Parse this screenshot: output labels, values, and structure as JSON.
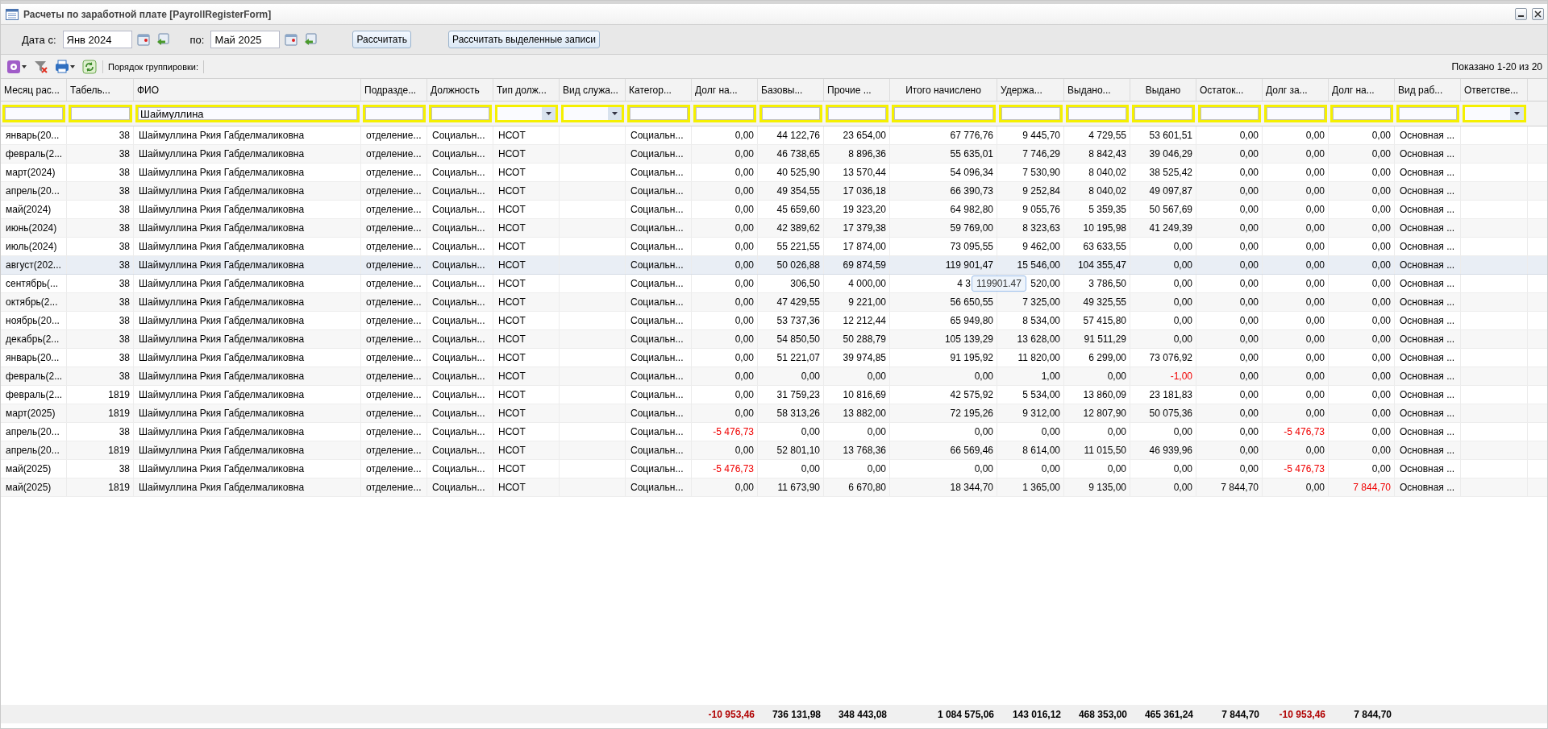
{
  "window": {
    "title": "Расчеты по заработной плате [PayrollRegisterForm]"
  },
  "period": {
    "from_label": "Дата с:",
    "from_value": "Янв 2024",
    "to_label": "по:",
    "to_value": "Май 2025"
  },
  "buttons": [
    "Рассчитать",
    "Рассчитать выделенные записи"
  ],
  "toolbar": {
    "grouping_label": "Порядок группировки:",
    "paging": "Показано 1-20 из 20"
  },
  "columns": [
    {
      "label": "Месяц рас...",
      "kind": "text",
      "header_centered": false,
      "filter": {
        "kind": "field"
      }
    },
    {
      "label": "Табель...",
      "kind": "number",
      "header_centered": false,
      "filter": {
        "kind": "field"
      }
    },
    {
      "label": "ФИО",
      "kind": "text",
      "header_centered": false,
      "filter": {
        "kind": "field",
        "value": "Шаймуллина"
      }
    },
    {
      "label": "Подразде...",
      "kind": "text",
      "header_centered": false,
      "filter": {
        "kind": "field"
      }
    },
    {
      "label": "Должность",
      "kind": "text",
      "header_centered": false,
      "filter": {
        "kind": "field"
      }
    },
    {
      "label": "Тип долж...",
      "kind": "text",
      "header_centered": false,
      "filter": {
        "kind": "combo"
      }
    },
    {
      "label": "Вид служа...",
      "kind": "text",
      "header_centered": false,
      "filter": {
        "kind": "combo"
      }
    },
    {
      "label": "Категор...",
      "kind": "text",
      "header_centered": false,
      "filter": {
        "kind": "field"
      }
    },
    {
      "label": "Долг на...",
      "kind": "number",
      "header_centered": false,
      "filter": {
        "kind": "field"
      },
      "total": {
        "text": "-10 953,46",
        "negative": true
      }
    },
    {
      "label": "Базовы...",
      "kind": "number",
      "header_centered": false,
      "filter": {
        "kind": "field"
      },
      "total": "736 131,98"
    },
    {
      "label": "Прочие ...",
      "kind": "number",
      "header_centered": false,
      "filter": {
        "kind": "field"
      },
      "total": "348 443,08"
    },
    {
      "label": "Итого начислено",
      "kind": "number",
      "header_centered": true,
      "filter": {
        "kind": "field"
      },
      "total": "1 084 575,06"
    },
    {
      "label": "Удержа...",
      "kind": "number",
      "header_centered": false,
      "filter": {
        "kind": "field"
      },
      "total": "143 016,12"
    },
    {
      "label": "Выдано...",
      "kind": "number",
      "header_centered": false,
      "filter": {
        "kind": "field"
      },
      "total": "468 353,00"
    },
    {
      "label": "Выдано",
      "kind": "number",
      "header_centered": true,
      "filter": {
        "kind": "field"
      },
      "total": "465 361,24"
    },
    {
      "label": "Остаток...",
      "kind": "number",
      "header_centered": false,
      "filter": {
        "kind": "field"
      },
      "total": "7 844,70"
    },
    {
      "label": "Долг за...",
      "kind": "number",
      "header_centered": false,
      "filter": {
        "kind": "field"
      },
      "total": {
        "text": "-10 953,46",
        "negative": true
      }
    },
    {
      "label": "Долг на...",
      "kind": "number",
      "header_centered": false,
      "filter": {
        "kind": "field"
      },
      "total": "7 844,70"
    },
    {
      "label": "Вид раб...",
      "kind": "text",
      "header_centered": false,
      "filter": {
        "kind": "field"
      }
    },
    {
      "label": "Ответстве...",
      "kind": "text",
      "header_centered": false,
      "filter": {
        "kind": "combo"
      }
    }
  ],
  "rows": [
    {
      "selected": false,
      "cells": [
        "январь(20...",
        "38",
        "Шаймуллина Ркия Габделмаликовна",
        "отделение...",
        "Социальн...",
        "НСОТ",
        null,
        "Социальн...",
        "0,00",
        "44 122,76",
        "23 654,00",
        "67 776,76",
        "9 445,70",
        "4 729,55",
        "53 601,51",
        "0,00",
        "0,00",
        "0,00",
        "Основная ...",
        null
      ]
    },
    {
      "selected": false,
      "cells": [
        "февраль(2...",
        "38",
        "Шаймуллина Ркия Габделмаликовна",
        "отделение...",
        "Социальн...",
        "НСОТ",
        null,
        "Социальн...",
        "0,00",
        "46 738,65",
        "8 896,36",
        "55 635,01",
        "7 746,29",
        "8 842,43",
        "39 046,29",
        "0,00",
        "0,00",
        "0,00",
        "Основная ...",
        null
      ]
    },
    {
      "selected": false,
      "cells": [
        "март(2024)",
        "38",
        "Шаймуллина Ркия Габделмаликовна",
        "отделение...",
        "Социальн...",
        "НСОТ",
        null,
        "Социальн...",
        "0,00",
        "40 525,90",
        "13 570,44",
        "54 096,34",
        "7 530,90",
        "8 040,02",
        "38 525,42",
        "0,00",
        "0,00",
        "0,00",
        "Основная ...",
        null
      ]
    },
    {
      "selected": false,
      "cells": [
        "апрель(20...",
        "38",
        "Шаймуллина Ркия Габделмаликовна",
        "отделение...",
        "Социальн...",
        "НСОТ",
        null,
        "Социальн...",
        "0,00",
        "49 354,55",
        "17 036,18",
        "66 390,73",
        "9 252,84",
        "8 040,02",
        "49 097,87",
        "0,00",
        "0,00",
        "0,00",
        "Основная ...",
        null
      ]
    },
    {
      "selected": false,
      "cells": [
        "май(2024)",
        "38",
        "Шаймуллина Ркия Габделмаликовна",
        "отделение...",
        "Социальн...",
        "НСОТ",
        null,
        "Социальн...",
        "0,00",
        "45 659,60",
        "19 323,20",
        "64 982,80",
        "9 055,76",
        "5 359,35",
        "50 567,69",
        "0,00",
        "0,00",
        "0,00",
        "Основная ...",
        null
      ]
    },
    {
      "selected": false,
      "cells": [
        "июнь(2024)",
        "38",
        "Шаймуллина Ркия Габделмаликовна",
        "отделение...",
        "Социальн...",
        "НСОТ",
        null,
        "Социальн...",
        "0,00",
        "42 389,62",
        "17 379,38",
        "59 769,00",
        "8 323,63",
        "10 195,98",
        "41 249,39",
        "0,00",
        "0,00",
        "0,00",
        "Основная ...",
        null
      ]
    },
    {
      "selected": false,
      "cells": [
        "июль(2024)",
        "38",
        "Шаймуллина Ркия Габделмаликовна",
        "отделение...",
        "Социальн...",
        "НСОТ",
        null,
        "Социальн...",
        "0,00",
        "55 221,55",
        "17 874,00",
        "73 095,55",
        "9 462,00",
        "63 633,55",
        "0,00",
        "0,00",
        "0,00",
        "0,00",
        "Основная ...",
        null
      ]
    },
    {
      "selected": true,
      "cells": [
        "август(202...",
        "38",
        "Шаймуллина Ркия Габделмаликовна",
        "отделение...",
        "Социальн...",
        "НСОТ",
        null,
        "Социальн...",
        "0,00",
        "50 026,88",
        "69 874,59",
        "119 901,47",
        "15 546,00",
        "104 355,47",
        "0,00",
        "0,00",
        "0,00",
        "0,00",
        "Основная ...",
        null
      ]
    },
    {
      "selected": false,
      "cells": [
        "сентябрь(...",
        "38",
        "Шаймуллина Ркия Габделмаликовна",
        "отделение...",
        "Социальн...",
        "НСОТ",
        null,
        "Социальн...",
        "0,00",
        "306,50",
        "4 000,00",
        {
          "text": "4 3",
          "tooltip": "119901.47"
        },
        "520,00",
        "3 786,50",
        "0,00",
        "0,00",
        "0,00",
        "0,00",
        "Основная ...",
        null
      ]
    },
    {
      "selected": false,
      "cells": [
        "октябрь(2...",
        "38",
        "Шаймуллина Ркия Габделмаликовна",
        "отделение...",
        "Социальн...",
        "НСОТ",
        null,
        "Социальн...",
        "0,00",
        "47 429,55",
        "9 221,00",
        "56 650,55",
        "7 325,00",
        "49 325,55",
        "0,00",
        "0,00",
        "0,00",
        "0,00",
        "Основная ...",
        null
      ]
    },
    {
      "selected": false,
      "cells": [
        "ноябрь(20...",
        "38",
        "Шаймуллина Ркия Габделмаликовна",
        "отделение...",
        "Социальн...",
        "НСОТ",
        null,
        "Социальн...",
        "0,00",
        "53 737,36",
        "12 212,44",
        "65 949,80",
        "8 534,00",
        "57 415,80",
        "0,00",
        "0,00",
        "0,00",
        "0,00",
        "Основная ...",
        null
      ]
    },
    {
      "selected": false,
      "cells": [
        "декабрь(2...",
        "38",
        "Шаймуллина Ркия Габделмаликовна",
        "отделение...",
        "Социальн...",
        "НСОТ",
        null,
        "Социальн...",
        "0,00",
        "54 850,50",
        "50 288,79",
        "105 139,29",
        "13 628,00",
        "91 511,29",
        "0,00",
        "0,00",
        "0,00",
        "0,00",
        "Основная ...",
        null
      ]
    },
    {
      "selected": false,
      "cells": [
        "январь(20...",
        "38",
        "Шаймуллина Ркия Габделмаликовна",
        "отделение...",
        "Социальн...",
        "НСОТ",
        null,
        "Социальн...",
        "0,00",
        "51 221,07",
        "39 974,85",
        "91 195,92",
        "11 820,00",
        "6 299,00",
        "73 076,92",
        "0,00",
        "0,00",
        "0,00",
        "Основная ...",
        null
      ]
    },
    {
      "selected": false,
      "cells": [
        "февраль(2...",
        "38",
        "Шаймуллина Ркия Габделмаликовна",
        "отделение...",
        "Социальн...",
        "НСОТ",
        null,
        "Социальн...",
        "0,00",
        "0,00",
        "0,00",
        "0,00",
        "1,00",
        "0,00",
        {
          "text": "-1,00",
          "negative": true
        },
        "0,00",
        "0,00",
        "0,00",
        "Основная ...",
        null
      ]
    },
    {
      "selected": false,
      "cells": [
        "февраль(2...",
        "1819",
        "Шаймуллина Ркия Габделмаликовна",
        "отделение...",
        "Социальн...",
        "НСОТ",
        null,
        "Социальн...",
        "0,00",
        "31 759,23",
        "10 816,69",
        "42 575,92",
        "5 534,00",
        "13 860,09",
        "23 181,83",
        "0,00",
        "0,00",
        "0,00",
        "Основная ...",
        null
      ]
    },
    {
      "selected": false,
      "cells": [
        "март(2025)",
        "1819",
        "Шаймуллина Ркия Габделмаликовна",
        "отделение...",
        "Социальн...",
        "НСОТ",
        null,
        "Социальн...",
        "0,00",
        "58 313,26",
        "13 882,00",
        "72 195,26",
        "9 312,00",
        "12 807,90",
        "50 075,36",
        "0,00",
        "0,00",
        "0,00",
        "Основная ...",
        null
      ]
    },
    {
      "selected": false,
      "cells": [
        "апрель(20...",
        "38",
        "Шаймуллина Ркия Габделмаликовна",
        "отделение...",
        "Социальн...",
        "НСОТ",
        null,
        "Социальн...",
        {
          "text": "-5 476,73",
          "negative": true
        },
        "0,00",
        "0,00",
        "0,00",
        "0,00",
        "0,00",
        "0,00",
        "0,00",
        {
          "text": "-5 476,73",
          "negative": true
        },
        "0,00",
        "Основная ...",
        null
      ]
    },
    {
      "selected": false,
      "cells": [
        "апрель(20...",
        "1819",
        "Шаймуллина Ркия Габделмаликовна",
        "отделение...",
        "Социальн...",
        "НСОТ",
        null,
        "Социальн...",
        "0,00",
        "52 801,10",
        "13 768,36",
        "66 569,46",
        "8 614,00",
        "11 015,50",
        "46 939,96",
        "0,00",
        "0,00",
        "0,00",
        "Основная ...",
        null
      ]
    },
    {
      "selected": false,
      "cells": [
        "май(2025)",
        "38",
        "Шаймуллина Ркия Габделмаликовна",
        "отделение...",
        "Социальн...",
        "НСОТ",
        null,
        "Социальн...",
        {
          "text": "-5 476,73",
          "negative": true
        },
        "0,00",
        "0,00",
        "0,00",
        "0,00",
        "0,00",
        "0,00",
        "0,00",
        {
          "text": "-5 476,73",
          "negative": true
        },
        "0,00",
        "Основная ...",
        null
      ]
    },
    {
      "selected": false,
      "cells": [
        "май(2025)",
        "1819",
        "Шаймуллина Ркия Габделмаликовна",
        "отделение...",
        "Социальн...",
        "НСОТ",
        null,
        "Социальн...",
        "0,00",
        "11 673,90",
        "6 670,80",
        "18 344,70",
        "1 365,00",
        "9 135,00",
        "0,00",
        "7 844,70",
        "0,00",
        {
          "text": "7 844,70",
          "negative": true
        },
        "Основная ...",
        null
      ]
    }
  ]
}
